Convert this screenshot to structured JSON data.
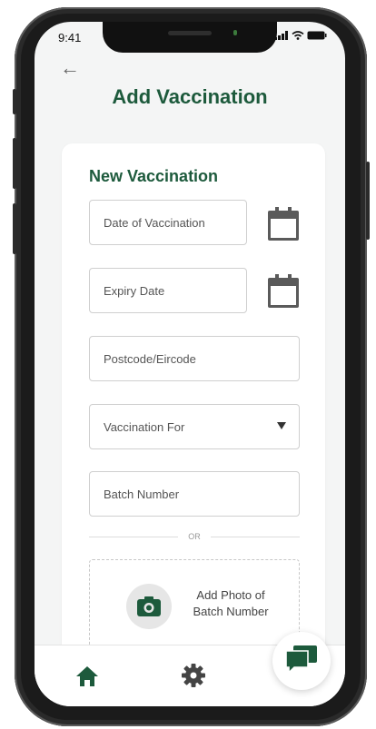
{
  "status_bar": {
    "time": "9:41"
  },
  "header": {
    "back_icon": "back-arrow-icon",
    "title": "Add Vaccination"
  },
  "form": {
    "title": "New Vaccination",
    "date_of_vaccination": {
      "placeholder": "Date of Vaccination",
      "value": ""
    },
    "expiry_date": {
      "placeholder": "Expiry Date",
      "value": ""
    },
    "postcode": {
      "placeholder": "Postcode/Eircode",
      "value": ""
    },
    "vaccination_for": {
      "selected": "Vaccination For"
    },
    "batch_number": {
      "placeholder": "Batch Number",
      "value": ""
    },
    "separator": "OR",
    "photo": {
      "label_line1": "Add Photo of",
      "label_line2": "Batch Number",
      "icon": "camera-icon"
    }
  },
  "bottom_nav": {
    "items": [
      {
        "icon": "home-icon"
      },
      {
        "icon": "gear-icon"
      }
    ]
  },
  "fab": {
    "icon": "chat-icon"
  },
  "colors": {
    "brand": "#1d5a3c",
    "calendar_icon": "#5a5a5a",
    "screen_bg": "#f4f5f5"
  }
}
